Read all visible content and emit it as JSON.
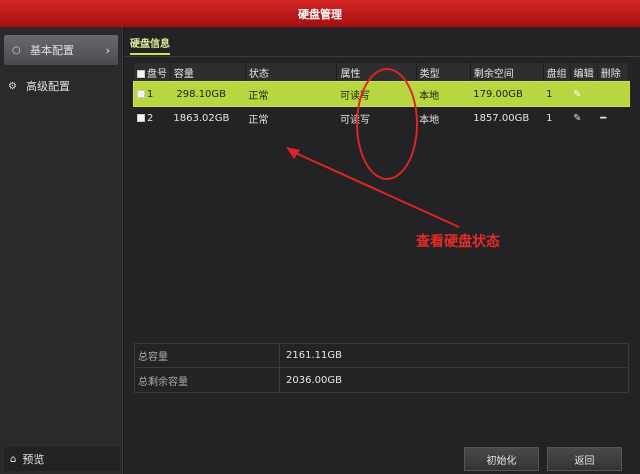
{
  "window": {
    "title": "硬盘管理"
  },
  "sidebar": {
    "items": [
      {
        "label": "基本配置",
        "icon": "circle-icon",
        "active": true
      },
      {
        "label": "高级配置",
        "icon": "gear-icon",
        "active": false
      }
    ],
    "bottom": {
      "label": "预览",
      "icon": "home-icon"
    }
  },
  "tab": {
    "label": "硬盘信息"
  },
  "table": {
    "headers": [
      "盘号",
      "容量",
      "状态",
      "属性",
      "类型",
      "剩余空间",
      "盘组",
      "编辑",
      "删除"
    ],
    "rows": [
      {
        "id": "1",
        "capacity": "298.10GB",
        "status": "正常",
        "attr": "可读写",
        "type": "本地",
        "free": "179.00GB",
        "group": "1",
        "edit": "✎",
        "delete": ""
      },
      {
        "id": "2",
        "capacity": "1863.02GB",
        "status": "正常",
        "attr": "可读写",
        "type": "本地",
        "free": "1857.00GB",
        "group": "1",
        "edit": "✎",
        "delete": "━"
      }
    ]
  },
  "annotation": {
    "text": "查看硬盘状态",
    "color": "#e62a2a"
  },
  "summary": {
    "total_label": "总容量",
    "total_value": "2161.11GB",
    "free_label": "总剩余容量",
    "free_value": "2036.00GB"
  },
  "buttons": {
    "init": "初始化",
    "back": "返回"
  },
  "colors": {
    "titlebar": "#c01a1a",
    "selected_row": "#b8d640",
    "tab_accent": "#cfe04a"
  }
}
